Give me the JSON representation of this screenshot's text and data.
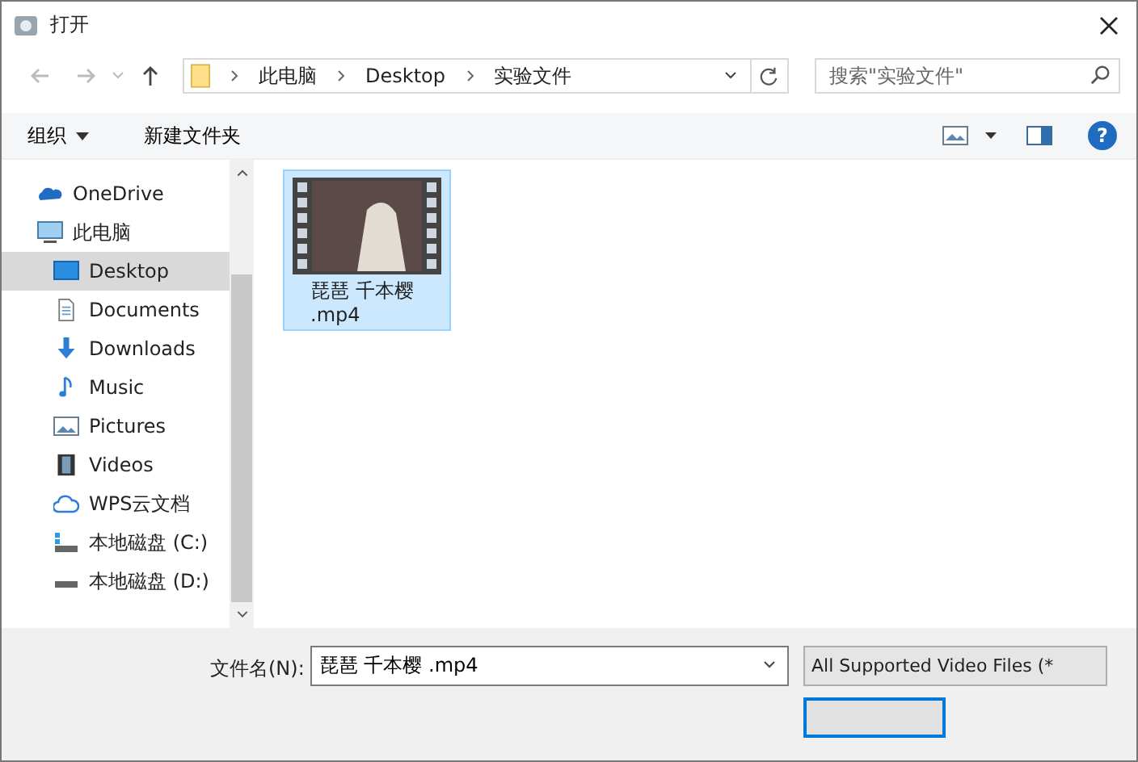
{
  "window": {
    "title": "打开"
  },
  "address": {
    "crumbs": [
      "此电脑",
      "Desktop",
      "实验文件"
    ]
  },
  "search": {
    "placeholder": "搜索\"实验文件\""
  },
  "toolbar": {
    "organize": "组织",
    "new_folder": "新建文件夹",
    "help": "?"
  },
  "sidebar": {
    "items": [
      {
        "label": "OneDrive",
        "kind": "cloud",
        "selected": false
      },
      {
        "label": "此电脑",
        "kind": "pc",
        "selected": false,
        "children": [
          {
            "label": "Desktop",
            "kind": "desktop",
            "selected": true
          },
          {
            "label": "Documents",
            "kind": "document",
            "selected": false
          },
          {
            "label": "Downloads",
            "kind": "download",
            "selected": false
          },
          {
            "label": "Music",
            "kind": "music",
            "selected": false
          },
          {
            "label": "Pictures",
            "kind": "picture",
            "selected": false
          },
          {
            "label": "Videos",
            "kind": "video",
            "selected": false
          },
          {
            "label": "WPS云文档",
            "kind": "wps",
            "selected": false
          },
          {
            "label": "本地磁盘 (C:)",
            "kind": "drive_sys",
            "selected": false
          },
          {
            "label": "本地磁盘 (D:)",
            "kind": "drive",
            "selected": false
          }
        ]
      }
    ]
  },
  "files": [
    {
      "name_lines": [
        "琵琶 千本樱",
        ".mp4"
      ],
      "selected": true
    }
  ],
  "bottom": {
    "file_name_label": "文件名(N):",
    "file_name_value": "琵琶 千本樱 .mp4",
    "filter": "All Supported Video Files (*"
  }
}
